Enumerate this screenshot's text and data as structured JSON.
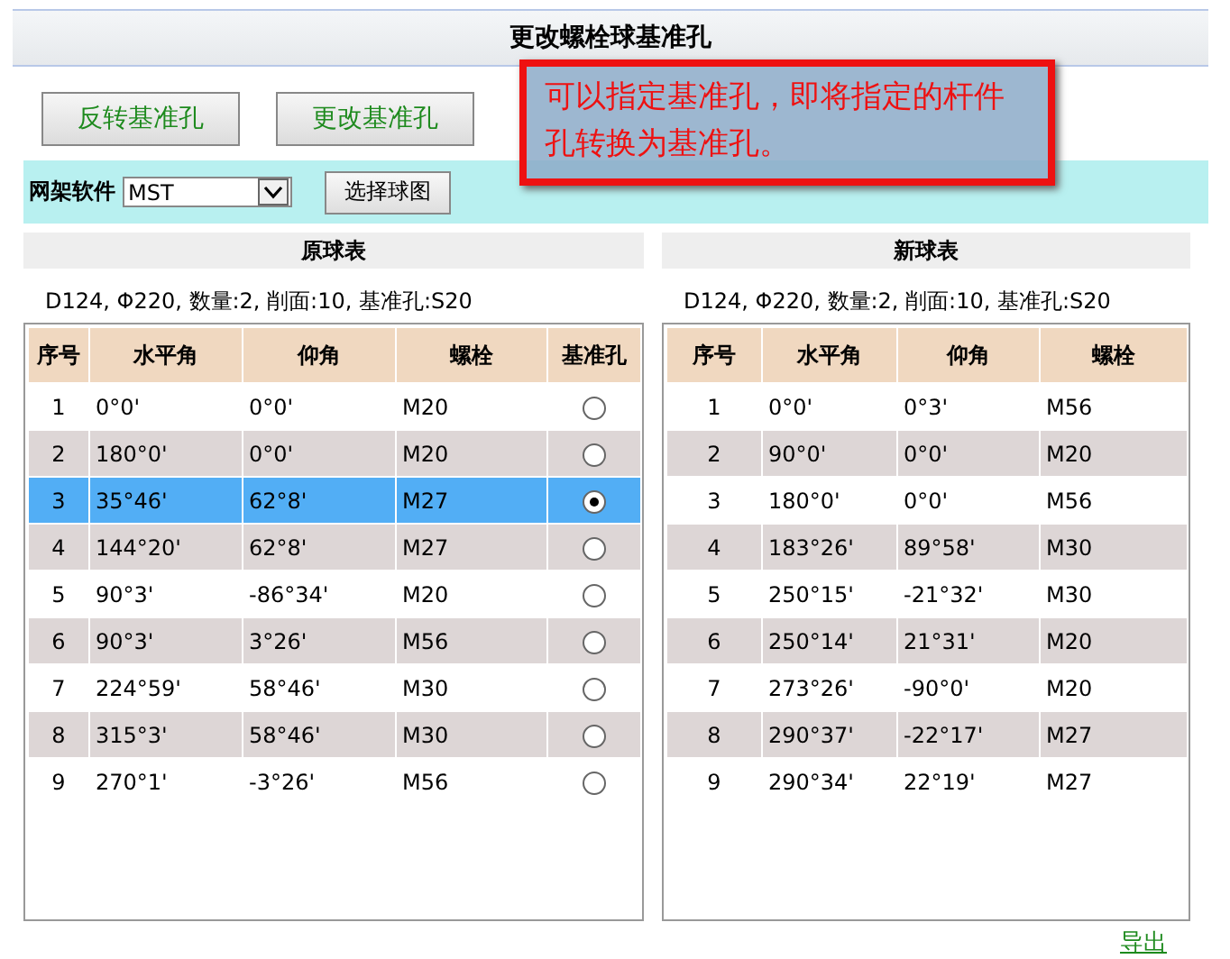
{
  "title": "更改螺栓球基准孔",
  "buttons": [
    "反转基准孔",
    "更改基准孔"
  ],
  "callout": "可以指定基准孔，即将指定的杆件孔转换为基准孔。",
  "toolbar": {
    "label": "网架软件",
    "select_value": "MST",
    "button": "选择球图"
  },
  "original": {
    "heading": "原球表",
    "info": "D124, Φ220, 数量:2, 削面:10, 基准孔:S20",
    "columns": [
      "序号",
      "水平角",
      "仰角",
      "螺栓",
      "基准孔"
    ],
    "rows": [
      {
        "cells": [
          "1",
          "0°0'",
          "0°0'",
          "M20"
        ],
        "selected": false,
        "checked": false
      },
      {
        "cells": [
          "2",
          "180°0'",
          "0°0'",
          "M20"
        ],
        "selected": false,
        "checked": false
      },
      {
        "cells": [
          "3",
          "35°46'",
          "62°8'",
          "M27"
        ],
        "selected": true,
        "checked": true
      },
      {
        "cells": [
          "4",
          "144°20'",
          "62°8'",
          "M27"
        ],
        "selected": false,
        "checked": false
      },
      {
        "cells": [
          "5",
          "90°3'",
          "-86°34'",
          "M20"
        ],
        "selected": false,
        "checked": false
      },
      {
        "cells": [
          "6",
          "90°3'",
          "3°26'",
          "M56"
        ],
        "selected": false,
        "checked": false
      },
      {
        "cells": [
          "7",
          "224°59'",
          "58°46'",
          "M30"
        ],
        "selected": false,
        "checked": false
      },
      {
        "cells": [
          "8",
          "315°3'",
          "58°46'",
          "M30"
        ],
        "selected": false,
        "checked": false
      },
      {
        "cells": [
          "9",
          "270°1'",
          "-3°26'",
          "M56"
        ],
        "selected": false,
        "checked": false
      }
    ]
  },
  "new": {
    "heading": "新球表",
    "info": "D124, Φ220, 数量:2, 削面:10, 基准孔:S20",
    "columns": [
      "序号",
      "水平角",
      "仰角",
      "螺栓"
    ],
    "rows": [
      {
        "cells": [
          "1",
          "0°0'",
          "0°3'",
          "M56"
        ],
        "selected": false
      },
      {
        "cells": [
          "2",
          "90°0'",
          "0°0'",
          "M20"
        ],
        "selected": false
      },
      {
        "cells": [
          "3",
          "180°0'",
          "0°0'",
          "M56"
        ],
        "selected": false
      },
      {
        "cells": [
          "4",
          "183°26'",
          "89°58'",
          "M30"
        ],
        "selected": false
      },
      {
        "cells": [
          "5",
          "250°15'",
          "-21°32'",
          "M30"
        ],
        "selected": false
      },
      {
        "cells": [
          "6",
          "250°14'",
          "21°31'",
          "M20"
        ],
        "selected": false
      },
      {
        "cells": [
          "7",
          "273°26'",
          "-90°0'",
          "M20"
        ],
        "selected": false
      },
      {
        "cells": [
          "8",
          "290°37'",
          "-22°17'",
          "M27"
        ],
        "selected": false
      },
      {
        "cells": [
          "9",
          "290°34'",
          "22°19'",
          "M27"
        ],
        "selected": false
      }
    ]
  },
  "export_link": "导出"
}
